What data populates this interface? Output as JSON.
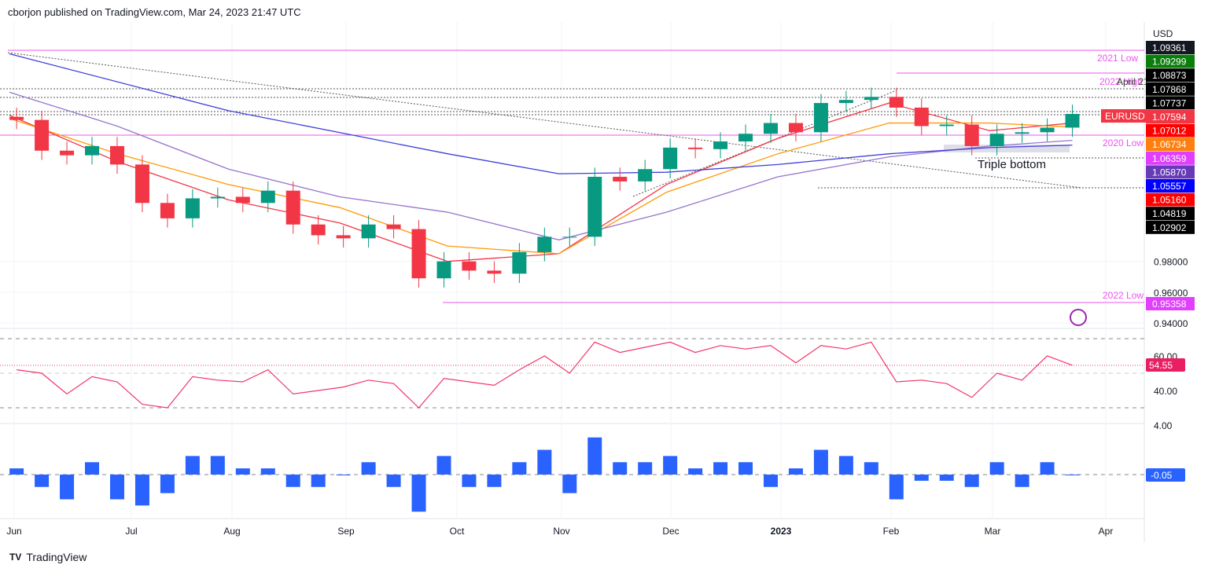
{
  "header": {
    "title": "cborjon published on TradingView.com, Mar 24, 2023 21:47 UTC"
  },
  "footer": {
    "brand": "TradingView"
  },
  "chart_data": [
    {
      "type": "candlestick",
      "symbol": "EURUSD",
      "currency": "USD",
      "ylim": [
        0.938,
        1.15
      ],
      "dates": [
        "2022-06-03",
        "2022-06-10",
        "2022-06-17",
        "2022-06-24",
        "2022-07-01",
        "2022-07-08",
        "2022-07-15",
        "2022-07-22",
        "2022-07-29",
        "2022-08-05",
        "2022-08-12",
        "2022-08-19",
        "2022-08-26",
        "2022-09-02",
        "2022-09-09",
        "2022-09-16",
        "2022-09-23",
        "2022-09-30",
        "2022-10-07",
        "2022-10-14",
        "2022-10-21",
        "2022-10-28",
        "2022-11-04",
        "2022-11-11",
        "2022-11-18",
        "2022-11-25",
        "2022-12-02",
        "2022-12-09",
        "2022-12-16",
        "2022-12-23",
        "2022-12-30",
        "2023-01-06",
        "2023-01-13",
        "2023-01-20",
        "2023-01-27",
        "2023-02-03",
        "2023-02-10",
        "2023-02-17",
        "2023-02-24",
        "2023-03-03",
        "2023-03-10",
        "2023-03-17",
        "2023-03-24"
      ],
      "close": [
        1.072,
        1.052,
        1.049,
        1.055,
        1.043,
        1.018,
        1.008,
        1.021,
        1.022,
        1.018,
        1.026,
        1.004,
        0.997,
        0.995,
        1.004,
        1.001,
        0.969,
        0.98,
        0.974,
        0.972,
        0.986,
        0.996,
        0.996,
        1.035,
        1.032,
        1.04,
        1.054,
        1.053,
        1.058,
        1.063,
        1.07,
        1.064,
        1.083,
        1.085,
        1.087,
        1.08,
        1.068,
        1.069,
        1.055,
        1.063,
        1.064,
        1.067,
        1.0759
      ],
      "first_open": 1.074,
      "moving_averages": [
        {
          "color": "#f23645",
          "dates": [
            "2022-06-01",
            "2022-07-01",
            "2022-08-01",
            "2022-09-01",
            "2022-10-01",
            "2022-11-01",
            "2022-12-01",
            "2023-01-01",
            "2023-02-01",
            "2023-03-01",
            "2023-03-24"
          ],
          "values": [
            1.075,
            1.045,
            1.02,
            1.005,
            0.98,
            0.985,
            1.03,
            1.06,
            1.083,
            1.065,
            1.07
          ],
          "last": "1.07012"
        },
        {
          "color": "#ff9800",
          "dates": [
            "2022-06-01",
            "2022-07-01",
            "2022-08-01",
            "2022-09-01",
            "2022-10-01",
            "2022-11-01",
            "2022-12-01",
            "2023-01-01",
            "2023-02-01",
            "2023-03-01",
            "2023-03-24"
          ],
          "values": [
            1.073,
            1.05,
            1.03,
            1.015,
            0.99,
            0.985,
            1.025,
            1.05,
            1.07,
            1.07,
            1.0673
          ],
          "last": "1.06734"
        },
        {
          "color": "#9575cd",
          "dates": [
            "2022-06-01",
            "2022-07-01",
            "2022-08-01",
            "2022-09-01",
            "2022-10-01",
            "2022-11-01",
            "2022-12-01",
            "2023-01-01",
            "2023-02-01",
            "2023-03-01",
            "2023-03-24"
          ],
          "values": [
            1.09,
            1.068,
            1.04,
            1.022,
            1.012,
            0.994,
            1.012,
            1.035,
            1.048,
            1.055,
            1.0587
          ],
          "last": "1.05870"
        },
        {
          "color": "#3f3fd9",
          "dates": [
            "2022-06-01",
            "2022-08-01",
            "2022-10-01",
            "2022-11-01",
            "2022-12-01",
            "2023-01-01",
            "2023-02-01",
            "2023-03-01",
            "2023-03-24"
          ],
          "values": [
            1.115,
            1.078,
            1.05,
            1.037,
            1.038,
            1.043,
            1.05,
            1.054,
            1.0556
          ],
          "last": "1.05557"
        }
      ],
      "levels": [
        {
          "label": "2021 Low",
          "value": "1.09299"
        },
        {
          "label": "2022 High",
          "value": "1.08873"
        },
        {
          "label": "April 21",
          "value": ""
        },
        {
          "label": "2020 Low",
          "value": "1.06359"
        },
        {
          "label": "2022 Low",
          "value": "0.95358"
        }
      ],
      "annotations": [
        "Triple bottom"
      ],
      "price_tags": [
        {
          "v": "1.09361",
          "bg": "#131722"
        },
        {
          "v": "1.09299",
          "bg": "#0a7d0a"
        },
        {
          "v": "1.08873",
          "bg": "#000"
        },
        {
          "v": "1.07868",
          "bg": "#000"
        },
        {
          "v": "1.07737",
          "bg": "#000"
        },
        {
          "v": "1.07594",
          "bg": "#f23645"
        },
        {
          "v": "1.07012",
          "bg": "#ff0000"
        },
        {
          "v": "1.06734",
          "bg": "#ff7f0e"
        },
        {
          "v": "1.06359",
          "bg": "#e040fb"
        },
        {
          "v": "1.05870",
          "bg": "#673ab7"
        },
        {
          "v": "1.05557",
          "bg": "#0000ff"
        },
        {
          "v": "1.05160",
          "bg": "#ff0000"
        },
        {
          "v": "1.04819",
          "bg": "#000"
        },
        {
          "v": "1.02902",
          "bg": "#000"
        },
        {
          "v": "0.95358",
          "bg": "#e040fb"
        }
      ],
      "y_ticks": [
        "0.98000",
        "0.96000",
        "0.94000"
      ],
      "x_ticks": [
        "Jun",
        "Jul",
        "Aug",
        "Sep",
        "Oct",
        "Nov",
        "Dec",
        "2023",
        "Feb",
        "Mar",
        "Apr"
      ]
    },
    {
      "type": "line",
      "ylim": [
        25,
        75
      ],
      "y_ticks": [
        "60.00",
        "40.00"
      ],
      "bands": [
        70,
        50,
        30
      ],
      "last": "54.55",
      "color": "#f23669",
      "values": [
        52,
        50,
        38,
        48,
        45,
        32,
        30,
        48,
        46,
        45,
        52,
        38,
        40,
        42,
        46,
        44,
        30,
        47,
        45,
        43,
        52,
        60,
        50,
        68,
        62,
        65,
        68,
        62,
        66,
        64,
        66,
        56,
        66,
        64,
        68,
        45,
        46,
        44,
        36,
        50,
        46,
        60,
        54.55
      ]
    },
    {
      "type": "bar",
      "y_ticks": [
        "4.00"
      ],
      "last": "-0.05",
      "color": "#2962ff",
      "values": [
        0.5,
        -1,
        -2,
        1,
        -2,
        -2.5,
        -1.5,
        1.5,
        1.5,
        0.5,
        0.5,
        -1,
        -1,
        0,
        1,
        -1,
        -3,
        1.5,
        -1,
        -1,
        1,
        2,
        -1.5,
        3,
        1,
        1,
        1.5,
        0.5,
        1,
        1,
        -1,
        0.5,
        2,
        1.5,
        1,
        -2,
        -0.5,
        -0.5,
        -1,
        1,
        -1,
        1,
        -0.05
      ]
    }
  ]
}
